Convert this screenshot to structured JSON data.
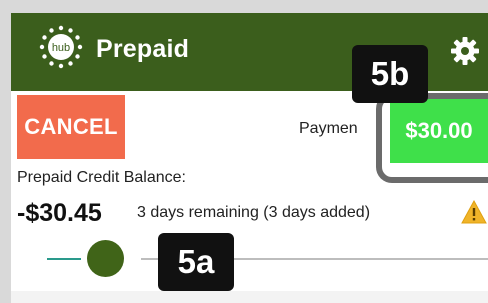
{
  "app": {
    "title": "Prepaid",
    "logo_text": "hub",
    "header_color": "#3b5e1c"
  },
  "actions": {
    "cancel_label": "CANCEL",
    "payment_label": "Paymen",
    "payment_amount": "$30.00"
  },
  "balance": {
    "label": "Prepaid Credit Balance:",
    "amount": "-$30.45",
    "days_text": "3 days remaining (3 days added)"
  },
  "slider": {
    "position": 0.2
  },
  "annotations": {
    "badge_b": "5b",
    "badge_a": "5a"
  },
  "icons": {
    "logo": "hub-logo-icon",
    "settings": "gear-icon",
    "warning": "warning-icon"
  },
  "colors": {
    "cancel": "#f26b4c",
    "pay": "#3fe04a",
    "slider_active": "#2a9a8c",
    "slider_knob": "#406418",
    "warning": "#f0b429"
  }
}
